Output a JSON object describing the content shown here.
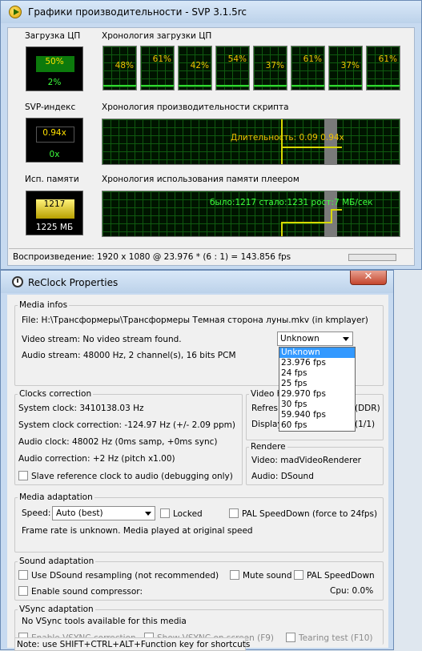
{
  "svp": {
    "title": "Графики производительности - SVP 3.1.5rc",
    "cpu_label": "Загрузка ЦП",
    "cpu_history_label": "Хронология загрузки ЦП",
    "cpu_top": "50%",
    "cpu_bottom": "2%",
    "cpu_cores": [
      "48%",
      "61%",
      "42%",
      "54%",
      "37%",
      "61%",
      "37%",
      "61%"
    ],
    "svp_index_label": "SVP-индекс",
    "script_history_label": "Хронология производительности скрипта",
    "index_top": "0.94x",
    "index_bottom": "0x",
    "script_text": "Длительность: 0.09  0.94x",
    "mem_label": "Исп. памяти",
    "mem_history_label": "Хронология использования памяти плеером",
    "mem_top": "1217",
    "mem_bottom": "1225 МБ",
    "mem_text": "было:1217 стало:1231 рост:7 МБ/сек",
    "status": "Воспроизведение: 1920 x 1080 @ 23.976 * (6 : 1) = 143.856 fps"
  },
  "reclock": {
    "title": "ReClock Properties",
    "close": "✕",
    "media_infos": "Media infos",
    "file": "File:   H:\\Трансформеры\\Трансформеры Темная сторона луны.mkv (in kmplayer)",
    "video_stream": "Video stream:  No video stream found.",
    "audio_stream": "Audio stream:  48000 Hz, 2 channel(s), 16 bits PCM",
    "combo_value": "Unknown",
    "options": [
      "Unknown",
      "23.976 fps",
      "24 fps",
      "25 fps",
      "29.970 fps",
      "30 fps",
      "59.940 fps",
      "60 fps"
    ],
    "clocks_correction": "Clocks correction",
    "system_clock": "System clock:  3410138.03 Hz",
    "system_clock_correction": "System clock correction:  -124.97 Hz (+/- 2.09 ppm)",
    "audio_clock": "Audio clock:  48002 Hz (0ms samp, +0ms sync)",
    "audio_correction": "Audio correction:  +2 Hz (pitch x1.00)",
    "slave_ref": "Slave reference clock to audio (debugging only)",
    "video_h": "Video h",
    "refresh": "Refres",
    "refresh_tail": "(DDR)",
    "display": "Display",
    "display_tail": "(1/1)",
    "renderer": "Rendere",
    "video_renderer": "Video:  madVideoRenderer",
    "audio_renderer": "Audio:  DSound",
    "media_adaptation": "Media adaptation",
    "speed_label": "Speed:",
    "speed_value": "Auto (best)",
    "locked": "Locked",
    "pal_speeddown_force": "PAL SpeedDown (force to 24fps)",
    "frame_rate_note": "Frame rate is unknown. Media played at original speed",
    "sound_adaptation": "Sound adaptation",
    "use_dsound": "Use DSound resampling (not recommended)",
    "mute_sound": "Mute sound",
    "pal_speeddown": "PAL SpeedDown",
    "enable_compressor": "Enable sound compressor:",
    "cpu": "Cpu:  0.0%",
    "vsync_adaptation": "VSync adaptation",
    "no_vsync": "No VSync tools available for this media",
    "enable_vsync": "Enable VSYNC correction",
    "show_vsync": "Show VSYNC on screen (F9)",
    "tearing_test": "Tearing test (F10)",
    "note": "Note: use SHIFT+CTRL+ALT+Function key for shortcuts"
  }
}
